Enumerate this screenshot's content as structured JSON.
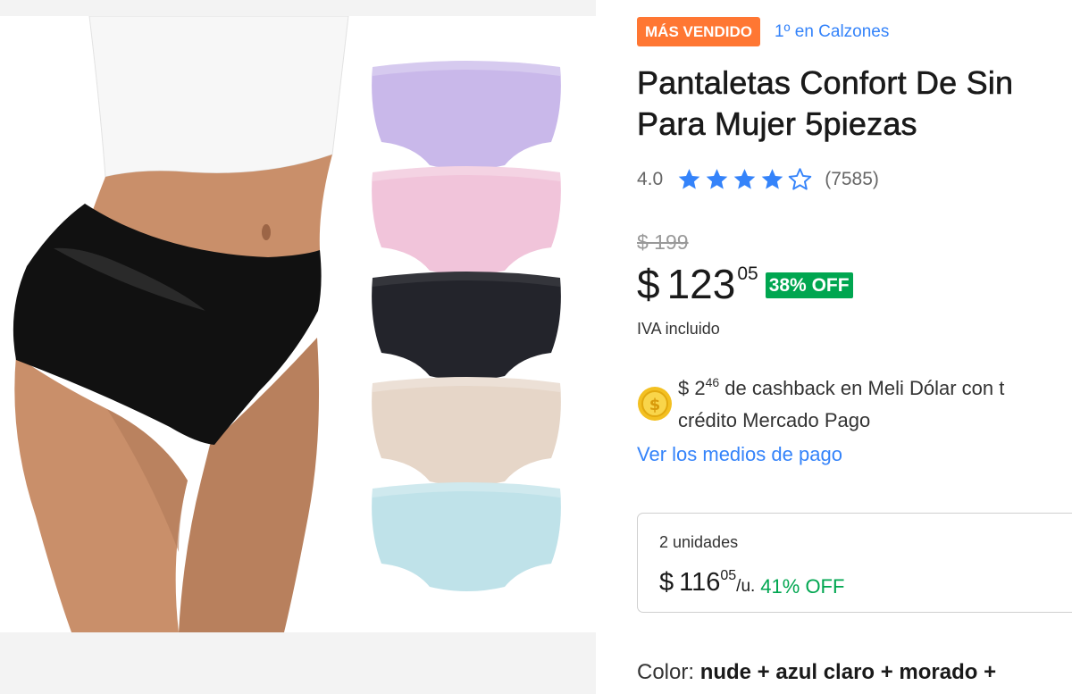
{
  "badge": {
    "label": "MÁS VENDIDO",
    "rank": "1º en Calzones",
    "color": "#ff7733"
  },
  "product": {
    "title_line1": "Pantaletas Confort De Sin",
    "title_line2": "Para Mujer 5piezas"
  },
  "rating": {
    "value": "4.0",
    "stars": 4,
    "max_stars": 5,
    "count": "(7585)",
    "star_color": "#3483fa"
  },
  "price": {
    "original": "$ 199",
    "currency": "$",
    "integer": "123",
    "cents": "05",
    "discount": "38% OFF",
    "tax_note": "IVA incluido"
  },
  "cashback": {
    "icon": "meli-dolar-coin-icon",
    "prefix": "$ 2",
    "cents": "46",
    "text_line1": " de cashback en Meli Dólar con t",
    "text_line2": "crédito Mercado Pago"
  },
  "payment_link": "Ver los medios de pago",
  "bulk_offer": {
    "units": "2 unidades",
    "currency": "$",
    "integer": "116",
    "cents": "05",
    "per_unit": "/u.",
    "discount": "41% OFF"
  },
  "color_selector": {
    "label": "Color: ",
    "value": "nude + azul claro + morado +"
  },
  "gallery": {
    "variant_colors": [
      "#c9b8ea",
      "#f1c4da",
      "#23242b",
      "#e6d6c8",
      "#bfe2e9"
    ],
    "main_garment_color": "#111111"
  },
  "accent_colors": {
    "link": "#3483fa",
    "success": "#00a650"
  }
}
